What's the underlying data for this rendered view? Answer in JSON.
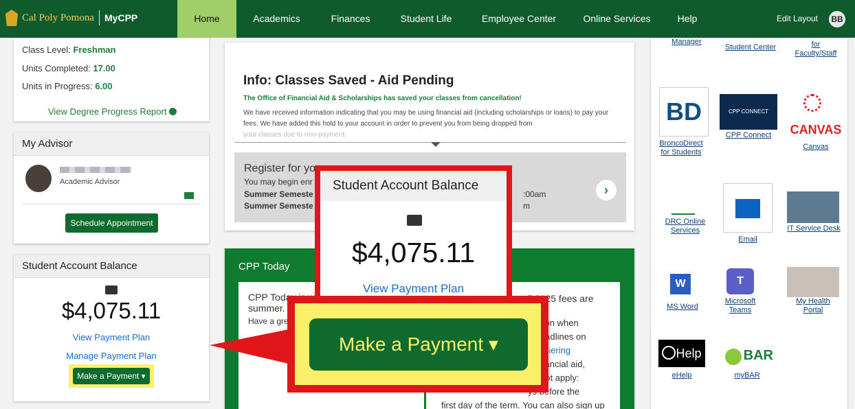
{
  "nav": {
    "brand": "Cal Poly Pomona",
    "product": "MyCPP",
    "items": [
      "Home",
      "Academics",
      "Finances",
      "Student Life",
      "Employee Center",
      "Online Services",
      "Help"
    ],
    "edit_layout": "Edit Layout",
    "avatar_initials": "BB"
  },
  "academic": {
    "class_level_label": "Class Level:",
    "class_level": "Freshman",
    "units_completed_label": "Units Completed:",
    "units_completed": "17.00",
    "units_progress_label": "Units in Progress:",
    "units_progress": "6.00",
    "degree_link": "View Degree Progress Report"
  },
  "advisor": {
    "title": "My Advisor",
    "role": "Academic Advisor",
    "button": "Schedule Appointment"
  },
  "balance": {
    "title": "Student Account Balance",
    "amount": "$4,075.11",
    "view_plan": "View Payment Plan",
    "manage_plan": "Manage Payment Plan",
    "pay_button": "Make a Payment"
  },
  "info": {
    "title": "Info: Classes Saved - Aid Pending",
    "subtitle": "The Office of Financial Aid & Scholarships has saved your classes from cancellation!",
    "body": "We have received information indicating that you may be using financial aid (including scholarships or loans) to pay your fees. We have added this hold to your account in order to prevent you from being dropped from",
    "body_faded": "your classes due to non-payment."
  },
  "register": {
    "title": "Register for yo",
    "line1": "You may begin enr",
    "line2": "Summer Semeste",
    "line3": "Summer Semeste",
    "time1": ":00am",
    "time2": "m"
  },
  "today": {
    "title": "CPP Today",
    "left_l1": "CPP Today is w",
    "left_l2": "summer.",
    "left_l3": "Have a gre",
    "right_l1": "all 2025 fees are",
    "right_l2": "sed on when",
    "right_l3": "e deadlines on",
    "right_l4": "Cashiering",
    "right_l5": "e financial aid,",
    "right_l6": "do not apply:",
    "right_l7": "ys before the",
    "right_l8": "first day of the term. You can also sign up"
  },
  "tiles": {
    "manager": "Manager",
    "student_center": "Student Center",
    "bd_faculty_1": "for",
    "bd_faculty_2": "Faculty/Staff",
    "bd_students_1": "BroncoDirect",
    "bd_students_2": "for Students",
    "bd_logo": "BD",
    "cpp_connect": "CPP Connect",
    "cpp_connect_logo": "CPP CONNECT",
    "canvas": "Canvas",
    "canvas_logo": "CANVAS",
    "drc_1": "DRC Online",
    "drc_2": "Services",
    "email": "Email",
    "it_desk": "IT Service Desk",
    "ms_word": "MS Word",
    "teams_1": "Microsoft",
    "teams_2": "Teams",
    "health_1": "My Health",
    "health_2": "Portal",
    "ehelp": "eHelp",
    "ehelp_logo": "Help",
    "mybar": "myBAR",
    "mybar_logo": "BAR"
  },
  "zoom": {
    "title": "Student Account Balance",
    "amount": "$4,075.11",
    "view_plan": "View Payment Plan",
    "pay_button": "Make a Payment"
  },
  "colors": {
    "nav_green": "#0f5b2c",
    "home_tab": "#a0cf6a",
    "highlight_red": "#e0161b",
    "highlight_yellow": "#fbf06a"
  }
}
